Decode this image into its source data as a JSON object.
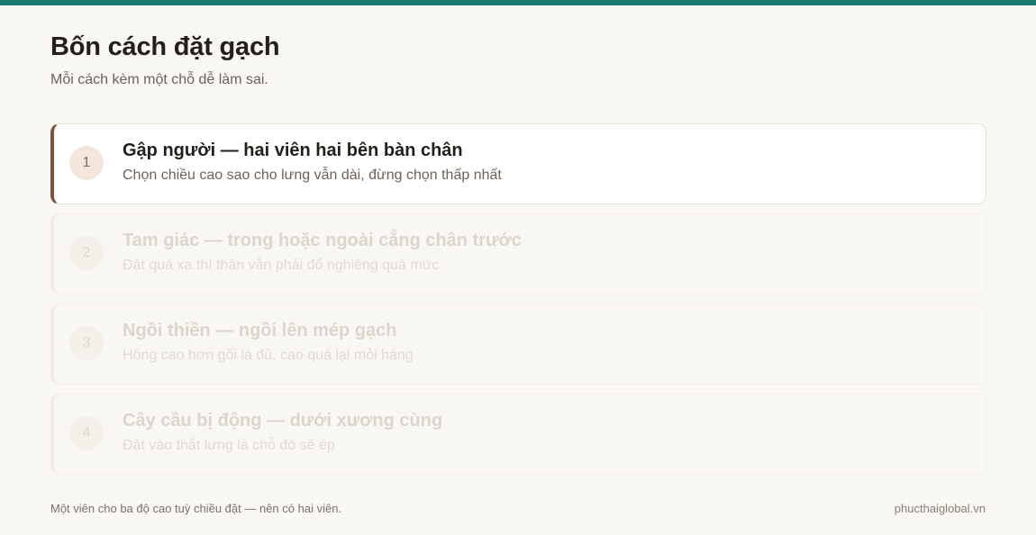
{
  "header": {
    "title": "Bốn cách đặt gạch",
    "subtitle": "Mỗi cách kèm một chỗ dễ làm sai."
  },
  "steps": [
    {
      "number": "1",
      "title": "Gập người — hai viên hai bên bàn chân",
      "description": "Chọn chiều cao sao cho lưng vẫn dài, đừng chọn thấp nhất",
      "state": "active"
    },
    {
      "number": "2",
      "title": "Tam giác — trong hoặc ngoài cẳng chân trước",
      "description": "Đặt quá xa thì thân vẫn phải đổ nghiêng quá mức",
      "state": "dim"
    },
    {
      "number": "3",
      "title": "Ngồi thiền — ngồi lên mép gạch",
      "description": "Hông cao hơn gối là đủ, cao quá lại mỏi háng",
      "state": "dim"
    },
    {
      "number": "4",
      "title": "Cây cầu bị động — dưới xương cùng",
      "description": "Đặt vào thắt lưng là chỗ đó sẽ ép",
      "state": "dim"
    }
  ],
  "footer": {
    "note": "Một viên cho ba độ cao tuỳ chiều đặt — nên có hai viên.",
    "site": "phucthaiglobal.vn"
  },
  "colors": {
    "accent_bar": "#1a7a6e",
    "active_border": "#7a5443"
  }
}
